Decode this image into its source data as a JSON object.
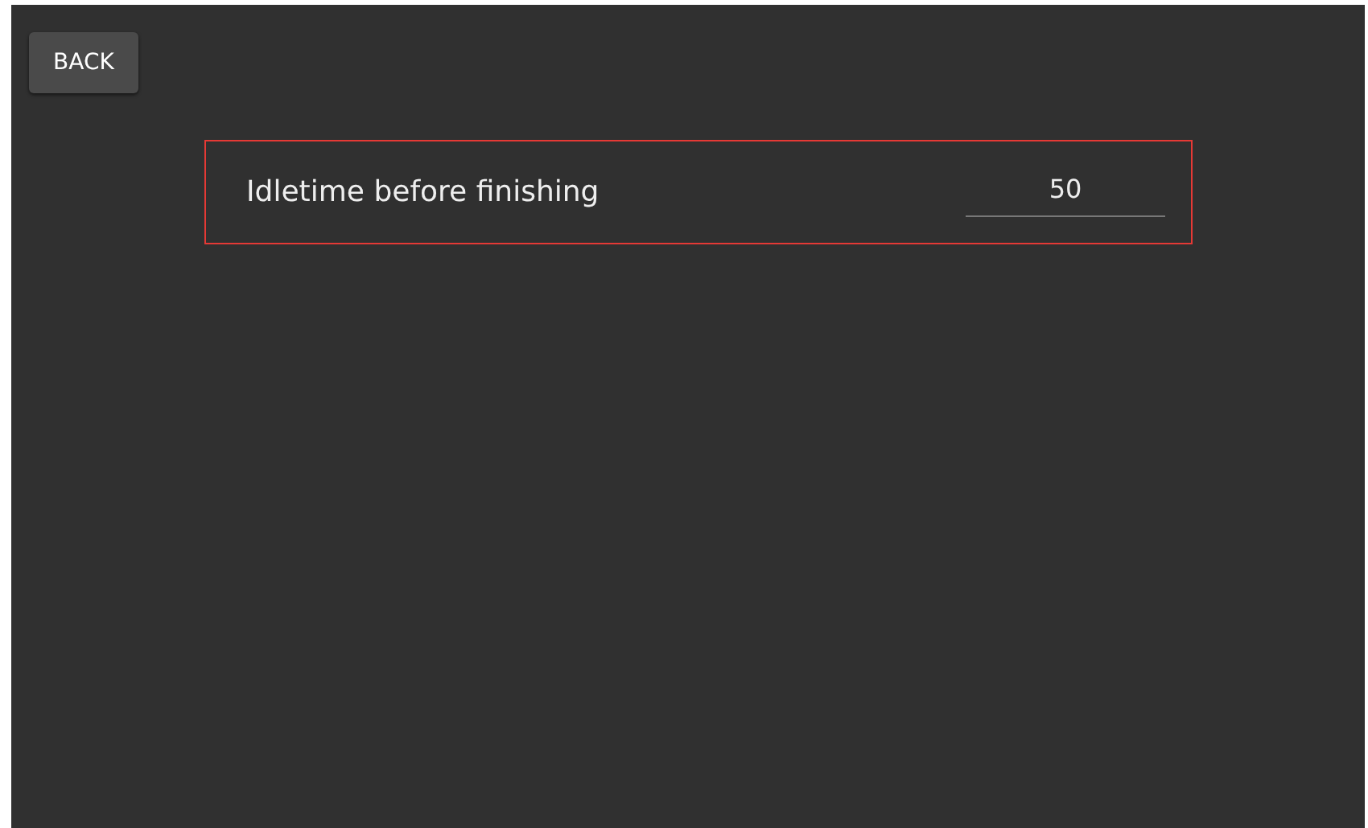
{
  "back_button": {
    "label": "BACK"
  },
  "setting": {
    "label": "Idletime before finishing",
    "value": "50",
    "highlighted": true
  }
}
